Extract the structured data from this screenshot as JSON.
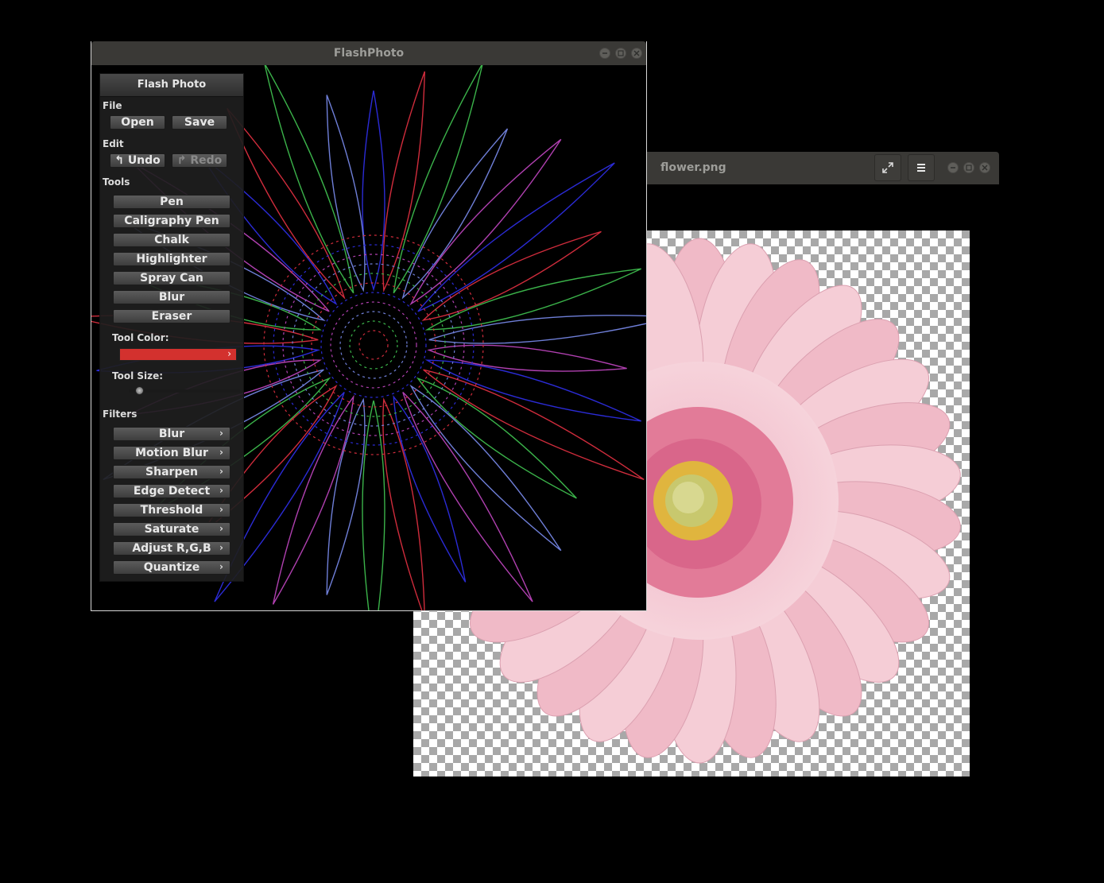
{
  "viewer": {
    "title": "flower.png",
    "fullscreen_icon": "fullscreen-icon",
    "menu_icon": "hamburger-menu-icon"
  },
  "flashphoto": {
    "window_title": "FlashPhoto",
    "panel_title": "Flash Photo",
    "file": {
      "label": "File",
      "open": "Open",
      "save": "Save"
    },
    "edit": {
      "label": "Edit",
      "undo": "Undo",
      "redo": "Redo"
    },
    "tools": {
      "label": "Tools",
      "items": [
        "Pen",
        "Caligraphy Pen",
        "Chalk",
        "Highlighter",
        "Spray Can",
        "Blur",
        "Eraser"
      ]
    },
    "tool_color": {
      "label": "Tool Color:",
      "value": "#d3312e"
    },
    "tool_size": {
      "label": "Tool Size:",
      "value": 0.05
    },
    "filters": {
      "label": "Filters",
      "items": [
        "Blur",
        "Motion Blur",
        "Sharpen",
        "Edge Detect",
        "Threshold",
        "Saturate",
        "Adjust R,G,B",
        "Quantize"
      ]
    }
  },
  "colors": {
    "titlebar": "#3a3936",
    "accent_swatch": "#d3312e",
    "petal_pink": "#f2bfcb",
    "flower_center": "#c7c56c"
  }
}
